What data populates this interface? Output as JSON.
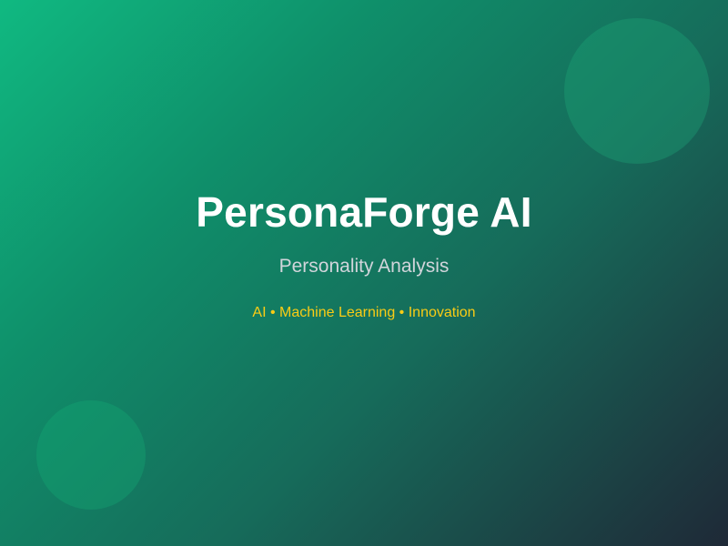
{
  "slide": {
    "title": "PersonaForge AI",
    "subtitle": "Personality Analysis",
    "tagline": "AI • Machine Learning • Innovation"
  },
  "colors": {
    "gradient_start": "#10b981",
    "gradient_end": "#1f2937",
    "title": "#ffffff",
    "subtitle": "#d1d5db",
    "tagline": "#facc15"
  }
}
